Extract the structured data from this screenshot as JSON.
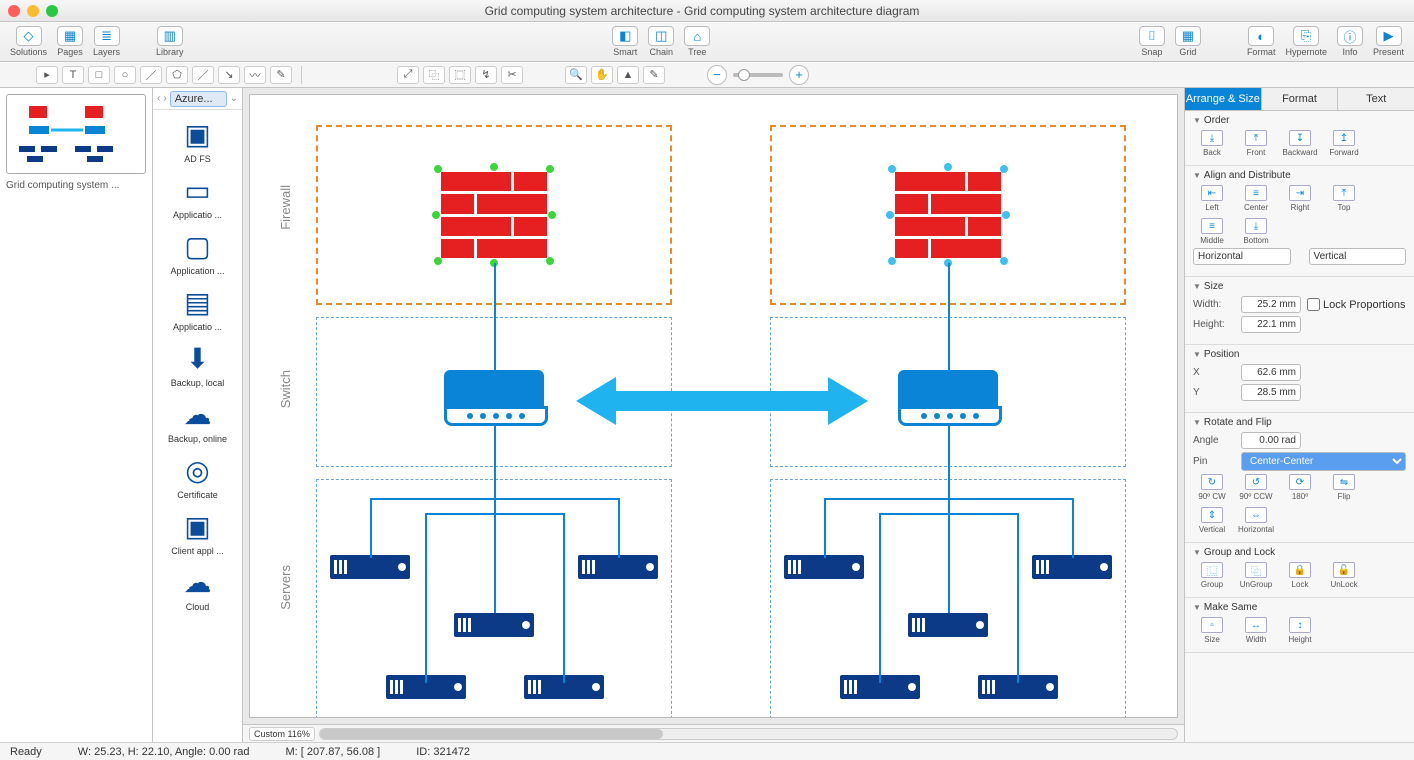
{
  "window": {
    "title": "Grid computing system architecture - Grid computing system architecture diagram"
  },
  "toolbar": {
    "left": [
      {
        "icon": "◇",
        "label": "Solutions"
      },
      {
        "icon": "▦",
        "label": "Pages"
      },
      {
        "icon": "≣",
        "label": "Layers"
      }
    ],
    "left2": [
      {
        "icon": "▥",
        "label": "Library"
      }
    ],
    "center": [
      {
        "icon": "◧",
        "label": "Smart"
      },
      {
        "icon": "◫",
        "label": "Chain"
      },
      {
        "icon": "⌂",
        "label": "Tree"
      }
    ],
    "right1": [
      {
        "icon": "⌷",
        "label": "Snap"
      },
      {
        "icon": "▦",
        "label": "Grid"
      }
    ],
    "right2": [
      {
        "icon": "◐",
        "label": "Format"
      },
      {
        "icon": "⎘",
        "label": "Hypernote"
      },
      {
        "icon": "ⓘ",
        "label": "Info"
      },
      {
        "icon": "▶",
        "label": "Present"
      }
    ]
  },
  "subtools": [
    "▸",
    "T",
    "□",
    "○",
    "／",
    "⬠",
    "／",
    "↘",
    "〰",
    "✎"
  ],
  "subtools2": [
    "⤢",
    "⿻",
    "⿴",
    "↯",
    "✂"
  ],
  "subtools3": [
    "🔍",
    "✋",
    "▲",
    "✎"
  ],
  "left": {
    "thumb_label": "Grid computing system ..."
  },
  "library": {
    "title": "Azure...",
    "items": [
      {
        "icon": "▣",
        "label": "AD FS"
      },
      {
        "icon": "▭",
        "label": "Applicatio ..."
      },
      {
        "icon": "▢",
        "label": "Application ..."
      },
      {
        "icon": "▤",
        "label": "Applicatio ..."
      },
      {
        "icon": "⬇",
        "label": "Backup, local"
      },
      {
        "icon": "☁",
        "label": "Backup, online"
      },
      {
        "icon": "◎",
        "label": "Certificate"
      },
      {
        "icon": "▣",
        "label": "Client appl ..."
      },
      {
        "icon": "☁",
        "label": "Cloud"
      }
    ]
  },
  "rows": [
    "Firewall",
    "Switch",
    "Servers"
  ],
  "zoom": {
    "label": "Custom 116%"
  },
  "status": {
    "ready": "Ready",
    "wh": "W: 25.23,  H: 22.10,  Angle: 0.00 rad",
    "m": "M: [ 207.87, 56.08 ]",
    "id": "ID: 321472"
  },
  "right": {
    "tabs": [
      "Arrange & Size",
      "Format",
      "Text"
    ],
    "order": {
      "head": "Order",
      "btns": [
        "Back",
        "Front",
        "Backward",
        "Forward"
      ]
    },
    "align": {
      "head": "Align and Distribute",
      "btns": [
        "Left",
        "Center",
        "Right",
        "Top",
        "Middle",
        "Bottom"
      ],
      "h": "Horizontal",
      "v": "Vertical"
    },
    "size": {
      "head": "Size",
      "wlbl": "Width:",
      "w": "25.2 mm",
      "hlbl": "Height:",
      "h": "22.1 mm",
      "lock": "Lock Proportions"
    },
    "pos": {
      "head": "Position",
      "xlbl": "X",
      "x": "62.6 mm",
      "ylbl": "Y",
      "y": "28.5 mm"
    },
    "rot": {
      "head": "Rotate and Flip",
      "albl": "Angle",
      "a": "0.00 rad",
      "plbl": "Pin",
      "p": "Center-Center",
      "btns": [
        "90º CW",
        "90º CCW",
        "180º",
        "Flip",
        "Vertical",
        "Horizontal"
      ]
    },
    "grp": {
      "head": "Group and Lock",
      "btns": [
        "Group",
        "UnGroup",
        "Lock",
        "UnLock"
      ]
    },
    "same": {
      "head": "Make Same",
      "btns": [
        "Size",
        "Width",
        "Height"
      ]
    }
  }
}
